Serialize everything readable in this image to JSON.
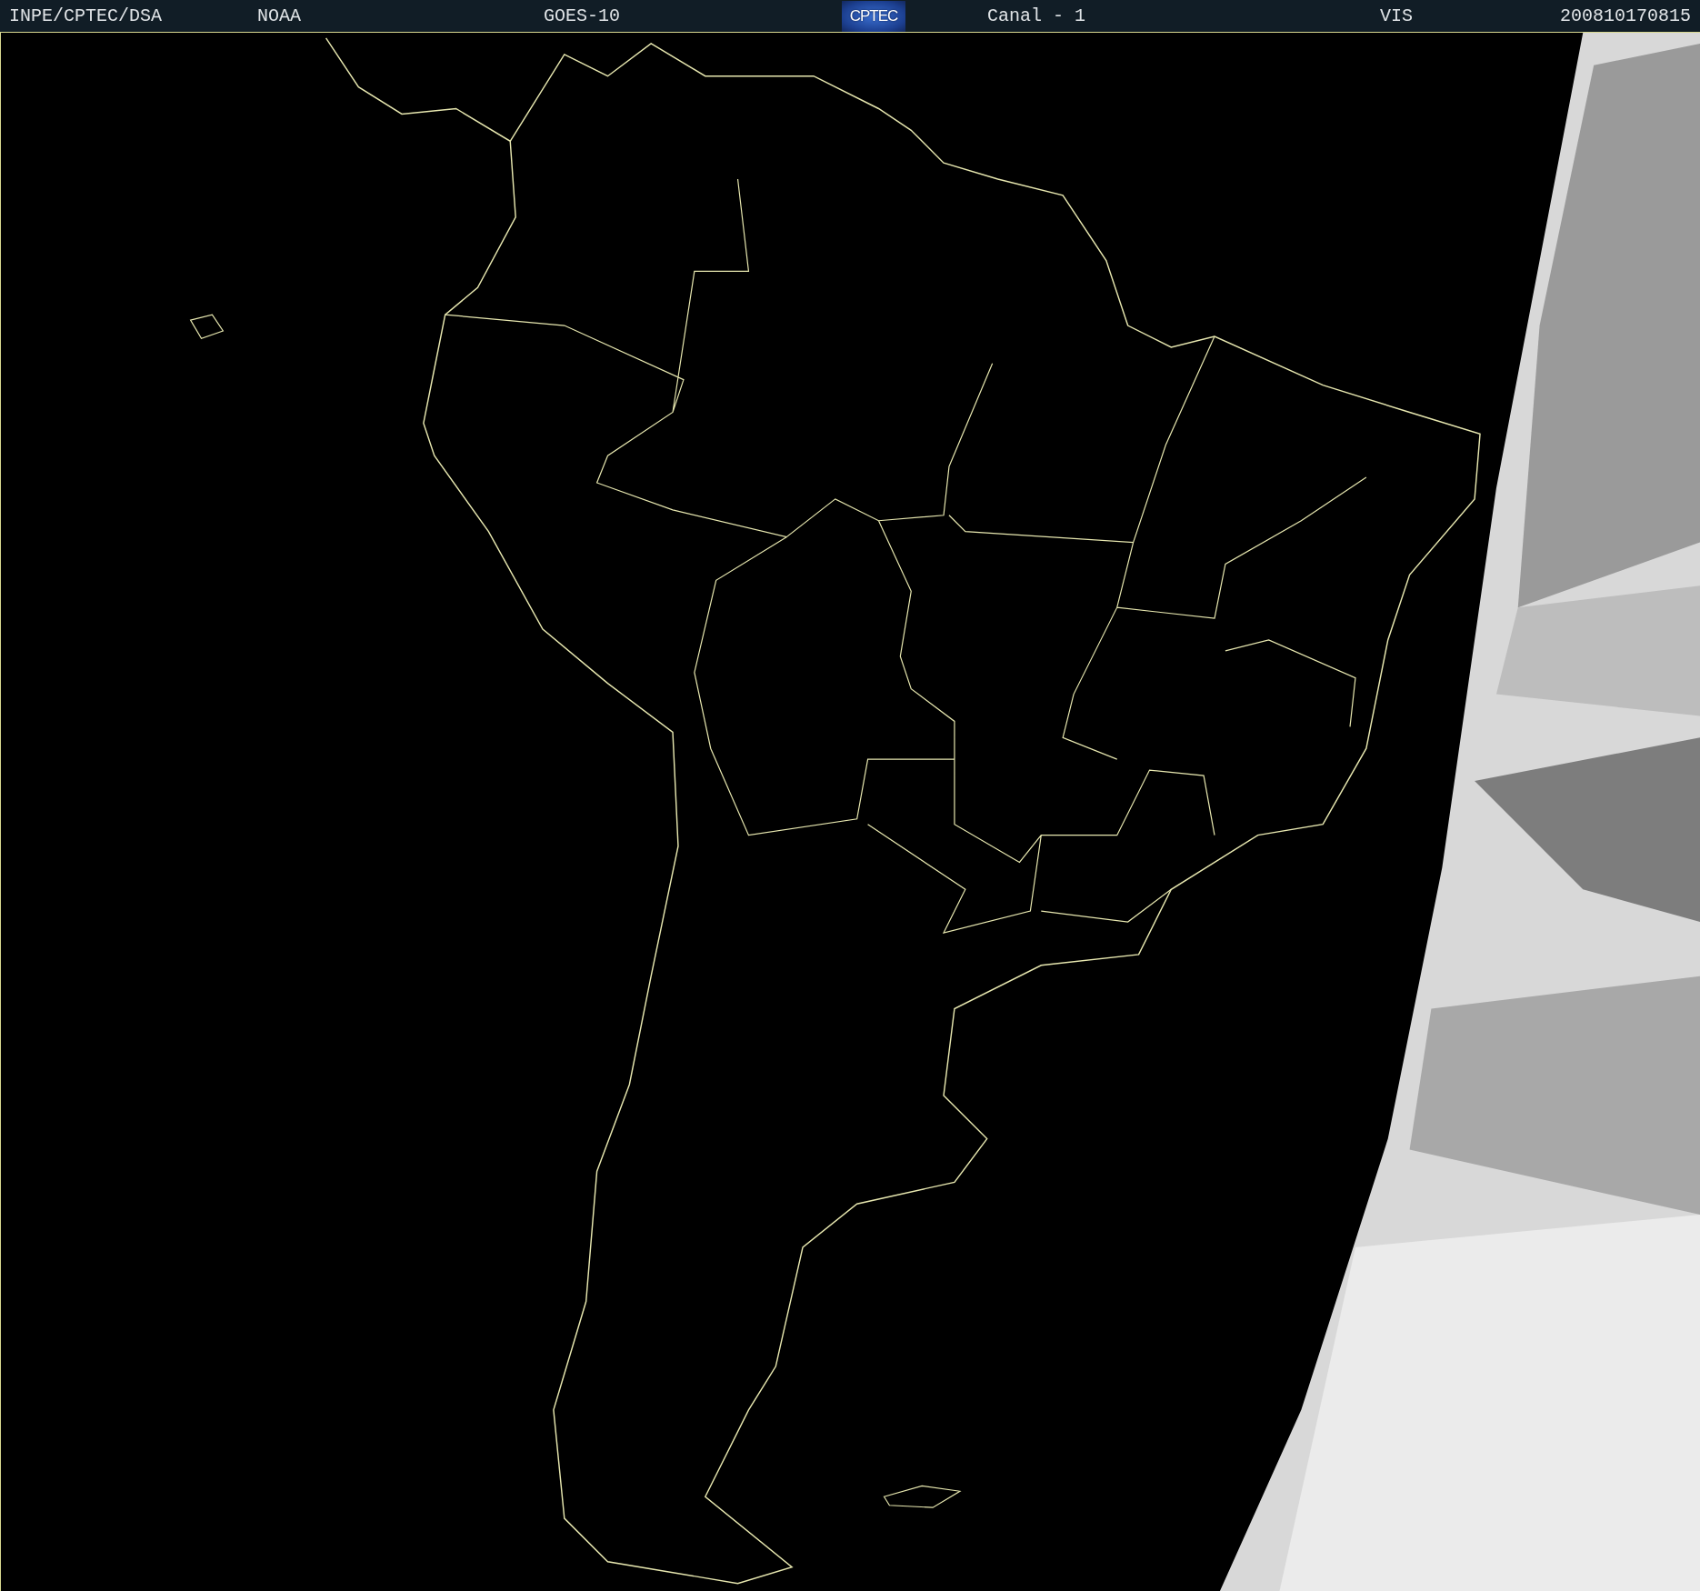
{
  "header": {
    "source": "INPE/CPTEC/DSA",
    "agency": "NOAA",
    "satellite": "GOES-10",
    "logo_text": "CPTEC",
    "channel": "Canal - 1",
    "band": "VIS",
    "timestamp": "200810170815"
  }
}
